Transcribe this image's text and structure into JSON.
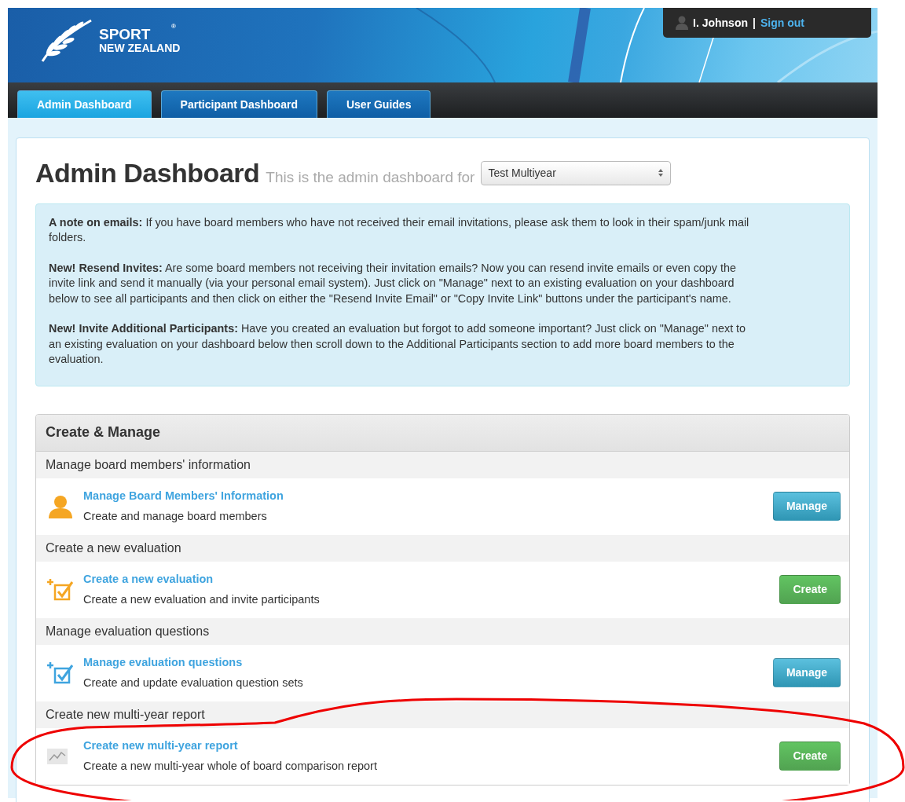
{
  "header": {
    "logo": {
      "line_1": "SPORT",
      "line_2": "NEW ZEALAND",
      "mark": "®"
    },
    "user": {
      "name": "I. Johnson",
      "separator": "|",
      "sign_out": "Sign out"
    }
  },
  "tabs": [
    {
      "label": "Admin Dashboard",
      "selected": true
    },
    {
      "label": "Participant Dashboard",
      "selected": false
    },
    {
      "label": "User Guides",
      "selected": false
    }
  ],
  "page": {
    "title": "Admin Dashboard",
    "subtitle": "This is the admin dashboard for",
    "select": {
      "value": "Test Multiyear"
    }
  },
  "notes": [
    "**A note on emails:** If you have board members who have not received their email invitations, please ask them to look in their spam/junk mail folders.",
    "**New! Resend Invites:** Are some board members not receiving their invitation emails? Now you can resend invite emails or even copy the invite link and send it manually (via your personal email system). Just click on \"Manage\" next to an existing evaluation on your dashboard below to see all participants and then click on either the \"Resend Invite Email\" or \"Copy Invite Link\" buttons under the participant's name.",
    "**New! Invite Additional Participants:** Have you created an evaluation but forgot to add someone important? Just click on \"Manage\" next to an existing evaluation on your dashboard below then scroll down to the Additional Participants section to add more board members to the evaluation."
  ],
  "panel": {
    "title": "Create & Manage",
    "sections": [
      {
        "heading": "Manage board members' information",
        "kind": "person",
        "title": "Manage Board Members' Information",
        "description": "Create and manage board members",
        "button": {
          "label": "Manage",
          "kind": "info"
        }
      },
      {
        "heading": "Create a new evaluation",
        "kind": "check-orange",
        "title": "Create a new evaluation",
        "description": "Create a new evaluation and invite participants",
        "button": {
          "label": "Create",
          "kind": "success"
        }
      },
      {
        "heading": "Manage evaluation questions",
        "kind": "check-blue",
        "title": "Manage evaluation questions",
        "description": "Create and update evaluation question sets",
        "button": {
          "label": "Manage",
          "kind": "info"
        }
      },
      {
        "heading": "Create new multi-year report",
        "kind": "chart",
        "title": "Create new multi-year report",
        "description": "Create a new multi-year whole of board comparison report",
        "button": {
          "label": "Create",
          "kind": "success"
        }
      }
    ]
  },
  "annotation": {
    "kind": "ellipse"
  }
}
